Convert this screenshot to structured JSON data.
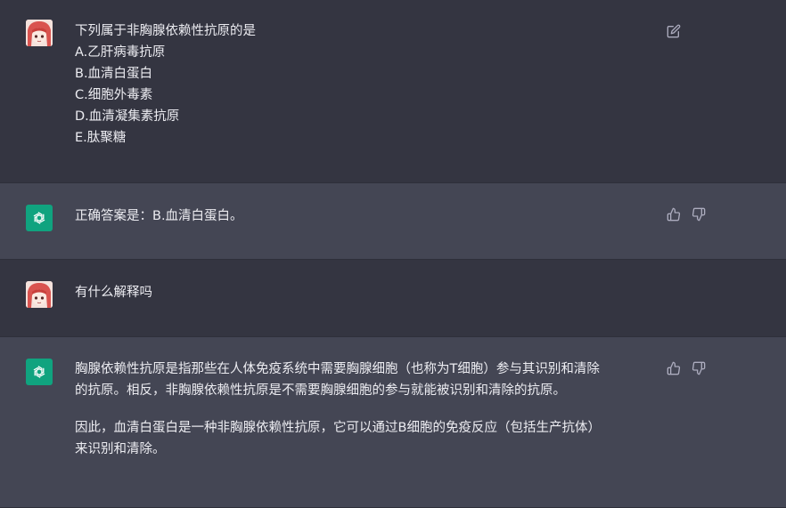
{
  "conversation": [
    {
      "role": "user",
      "lines": [
        "下列属于非胸腺依赖性抗原的是",
        "A.乙肝病毒抗原",
        "B.血清白蛋白",
        "C.细胞外毒素",
        "D.血清凝集素抗原",
        "E.肽聚糖"
      ]
    },
    {
      "role": "assistant",
      "text": "正确答案是：B.血清白蛋白。"
    },
    {
      "role": "user",
      "lines": [
        "有什么解释吗"
      ]
    },
    {
      "role": "assistant",
      "paragraphs": [
        [
          "胸腺依赖性抗原是指那些在人体免疫系统中需要胸腺细胞（也称为T细胞）参与其识别和清除",
          "的抗原。相反，非胸腺依赖性抗原是不需要胸腺细胞的参与就能被识别和清除的抗原。"
        ],
        [
          "因此，血清白蛋白是一种非胸腺依赖性抗原，它可以通过B细胞的免疫反应（包括生产抗体）",
          "来识别和清除。"
        ]
      ]
    }
  ],
  "icons": {
    "user_avatar": "anime-girl-avatar",
    "assistant_avatar": "openai-logo-icon",
    "edit": "edit-icon",
    "thumbs_up": "thumbs-up-icon",
    "thumbs_down": "thumbs-down-icon"
  },
  "colors": {
    "user_bg": "#343541",
    "assistant_bg": "#444654",
    "text": "#ececf1",
    "icon": "#acacbe",
    "bot_avatar": "#10a37f"
  }
}
